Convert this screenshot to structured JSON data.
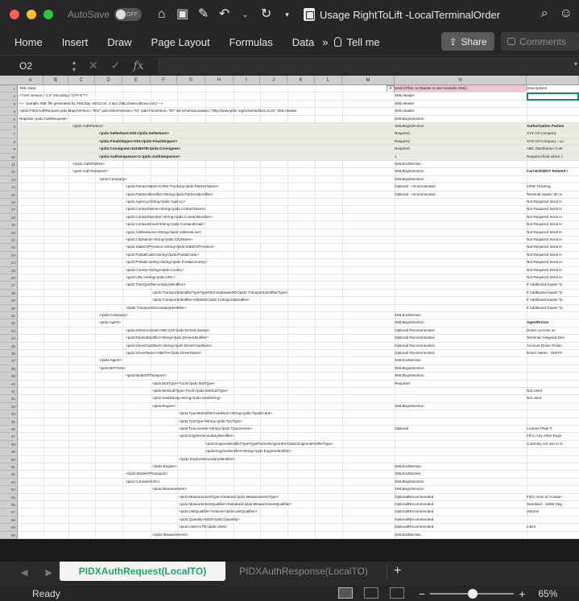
{
  "window": {
    "autosave_label": "AutoSave",
    "autosave_state": "OFF",
    "document_title": "Usage RightToLift -LocalTerminalOrder"
  },
  "ribbon": {
    "tabs": [
      "Home",
      "Insert",
      "Draw",
      "Page Layout",
      "Formulas",
      "Data"
    ],
    "more": "»",
    "tell_me": "Tell me",
    "share": "Share",
    "comments": "Comments"
  },
  "formula_bar": {
    "name_box": "O2",
    "fx": "fx",
    "value": ""
  },
  "grid": {
    "column_letters": [
      "A",
      "B",
      "C",
      "D",
      "E",
      "F",
      "G",
      "H",
      "I",
      "J",
      "K",
      "L",
      "M",
      "N"
    ],
    "col_n_header": "Used (Filter on Blanks to see example XML)",
    "col_o_header": "Descriptions",
    "rows": [
      {
        "num": "1",
        "a": "XML Data",
        "indent": 0,
        "n": "Used (Filter on Blanks to see example XML)",
        "o": "Descriptions",
        "hl": false,
        "hdr": true
      },
      {
        "num": "2",
        "a": "<?xml version=\"1.0\" encoding=\"UTF-8\"?>",
        "indent": 0,
        "n": "XMLHeader",
        "o": "",
        "hl": false
      },
      {
        "num": "3",
        "a": "<!-- Sample XML file generated by XMLSpy v2012 rel. 2 sp1 (http://www.altova.com) -->",
        "indent": 0,
        "n": "XMLHeader",
        "o": "",
        "hl": false
      },
      {
        "num": "4",
        "a": "<pidx:PIDXAuthRequest pidx:MajorVersion=\"001\" pidx:MinorVersion=\"01\" pidx:FixVersion=\"00\" xsi:schemaLocation=\"http://www.pidx.org/schema/lds/LIS.01\" XMLHeader",
        "indent": 0,
        "n": "XMLHeader",
        "o": "",
        "hl": false
      },
      {
        "num": "5",
        "a": "Repeats   <pidx:AuthRequest>",
        "indent": 0,
        "n": "XMLBeginSection",
        "o": "",
        "hl": false
      },
      {
        "num": "6",
        "a": "<pidx:AuthParties>",
        "indent": 2,
        "n": "XMLBeginSection",
        "o": "Authorization Parties",
        "hl": true,
        "bold": true
      },
      {
        "num": "7",
        "a": "<pidx:SellerNum>001</pidx:SellerNum>",
        "indent": 3,
        "n": "Required",
        "o": "XYZ Oil Company",
        "hl": true,
        "b": true
      },
      {
        "num": "8",
        "a": "<pidx:FinalShipper>001</pidx:FinalShipper>",
        "indent": 3,
        "n": "Required",
        "o": "XYZ Oil Company - Lo",
        "hl": true,
        "b": true
      },
      {
        "num": "9",
        "a": "<pidx:Consignee>12345678</pidx:Consignee>",
        "indent": 3,
        "n": "Required",
        "o": "ABC Distribution Cust",
        "hl": true,
        "b": true
      },
      {
        "num": "10",
        "a": "<pidx:AuthSequence>1</pidx:AuthSequence>",
        "indent": 3,
        "n": "1",
        "o": "Required field which c",
        "hl": true,
        "b": true
      },
      {
        "num": "11",
        "a": "</pidx:AuthParties>",
        "indent": 2,
        "n": "XMLEndSection",
        "o": "",
        "hl": false
      },
      {
        "num": "12",
        "a": "<pidx:AuthTransport>",
        "indent": 2,
        "n": "XMLBeginSection",
        "o": "Carrier/DWOT Related I",
        "hl": false,
        "bold": true
      },
      {
        "num": "13",
        "a": "<pidx:Company>",
        "indent": 3,
        "n": "XMLBeginSection",
        "o": "",
        "hl": false
      },
      {
        "num": "14",
        "a": "<pidx:PartnerName>CRW Trucking</pidx:PartnerName>",
        "indent": 4,
        "n": "Optional - recommended",
        "o": "CRW Trucking",
        "hl": false
      },
      {
        "num": "15",
        "a": "<pidx:PartnerIdentifier>String</pidx:PartnerIdentifier>",
        "indent": 4,
        "n": "Optional - recommended",
        "o": "Terminal Hauler ID cu",
        "hl": false
      },
      {
        "num": "16",
        "a": "<pidx:Agency>String</pidx:Agency>",
        "indent": 4,
        "n": "",
        "o": "Not Required Send in",
        "hl": false
      },
      {
        "num": "17",
        "a": "<pidx:ContactName>String</pidx:ContactName>",
        "indent": 4,
        "n": "",
        "o": "Not Required Send in",
        "hl": false
      },
      {
        "num": "18",
        "a": "<pidx:ContactNumber>String</pidx:ContactNumber>",
        "indent": 4,
        "n": "",
        "o": "Not Required Send in",
        "hl": false
      },
      {
        "num": "19",
        "a": "<pidx:ContactEmail>String</pidx:ContactEmail>",
        "indent": 4,
        "n": "",
        "o": "Not Required Send in",
        "hl": false
      },
      {
        "num": "20",
        "a": "<pidx:AddressLine>String</pidx:AddressLine>",
        "indent": 4,
        "n": "",
        "o": "Not Required Send in",
        "hl": false
      },
      {
        "num": "21",
        "a": "<pidx:CityName>String</pidx:CityName>",
        "indent": 4,
        "n": "",
        "o": "Not Required Send in",
        "hl": false
      },
      {
        "num": "22",
        "a": "<pidx:StateOrProvince>String</pidx:StateOrProvince>",
        "indent": 4,
        "n": "",
        "o": "Not Required Send in",
        "hl": false
      },
      {
        "num": "23",
        "a": "<pidx:PostalCode>String</pidx:PostalCode>",
        "indent": 4,
        "n": "",
        "o": "Not Required Send in",
        "hl": false
      },
      {
        "num": "24",
        "a": "<pidx:PostalCountry>String</pidx:PostalCountry>",
        "indent": 4,
        "n": "",
        "o": "Not Required Send in",
        "hl": false
      },
      {
        "num": "25",
        "a": "<pidx:County>String</pidx:County>",
        "indent": 4,
        "n": "",
        "o": "Not Required Send in",
        "hl": false
      },
      {
        "num": "26",
        "a": "<pidx:URL>String</pidx:URL>",
        "indent": 4,
        "n": "",
        "o": "Not Required Send in",
        "hl": false
      },
      {
        "num": "27",
        "a": "<pidx:TransportSecondaryIdentifier>",
        "indent": 4,
        "n": "",
        "o": "If Additional Hauler Ty",
        "hl": false
      },
      {
        "num": "28",
        "a": "<pidx:TransportIdentifierTypeTypeTerminalHaulerID</pidx:TransportIdentifierType>",
        "indent": 5,
        "n": "",
        "o": "If Additional Hauler Ty",
        "hl": false
      },
      {
        "num": "29",
        "a": "<pidx:TransportIdentifier>000000</pidx:TransportIdentifier>",
        "indent": 5,
        "n": "",
        "o": "If Additional Hauler Ty",
        "hl": false
      },
      {
        "num": "30",
        "a": "</pidx:TransportSecondaryIdentifier>",
        "indent": 4,
        "n": "",
        "o": "If Additional Hauler Ty",
        "hl": false
      },
      {
        "num": "31",
        "a": "</pidx:Company>",
        "indent": 3,
        "n": "XMLEndSection",
        "o": "",
        "hl": false
      },
      {
        "num": "32",
        "a": "<pidx:Agent>",
        "indent": 3,
        "n": "XMLBeginSection",
        "o": "Agent/Driver",
        "hl": false,
        "bold": true
      },
      {
        "num": "33",
        "a": "<pidx:DriverLicense>ABC123</pidx:DriverLicense>",
        "indent": 4,
        "n": "Optional Recommended",
        "o": "Driver License no",
        "hl": false
      },
      {
        "num": "34",
        "a": "<pidx:DriverIdentifier>String</pidx:DriverIdentifier>",
        "indent": 4,
        "n": "Optional Recommended",
        "o": "Terminal Assigned Driv",
        "hl": false
      },
      {
        "num": "35",
        "a": "<pidx:DriverCardNum>String</pidx:DriverCardNum>",
        "indent": 4,
        "n": "Optional Recommended",
        "o": "Account Driver Pickin",
        "hl": false
      },
      {
        "num": "36",
        "a": "<pidx:DriverName>SMITH</pidx:DriverName>",
        "indent": 4,
        "n": "Optional Recommended",
        "o": "Driver Name - SMITH",
        "hl": false
      },
      {
        "num": "37",
        "a": "</pidx:Agent>",
        "indent": 3,
        "n": "XMLEndSection",
        "o": "",
        "hl": false
      },
      {
        "num": "38",
        "a": "<pidx:MOTInfo>",
        "indent": 3,
        "n": "XMLBeginSection",
        "o": "",
        "hl": false
      },
      {
        "num": "39",
        "a": "<pidx:ModeOfTransport>",
        "indent": 4,
        "n": "XMLBeginSection",
        "o": "",
        "hl": false
      },
      {
        "num": "40",
        "a": "<pidx:MotType>Truck</pidx:MotType>",
        "indent": 5,
        "n": "Required",
        "o": "",
        "hl": false
      },
      {
        "num": "41",
        "a": "<pidx:MotSubType>Truck</pidx:MotSubType>",
        "indent": 5,
        "n": "",
        "o": "Not Used",
        "hl": false
      },
      {
        "num": "42",
        "a": "<pidx:SealString>String</pidx:SealString>",
        "indent": 5,
        "n": "",
        "o": "Not used",
        "hl": false
      },
      {
        "num": "43",
        "a": "<pidx:Engine>",
        "indent": 5,
        "n": "XMLBeginSection",
        "o": "",
        "hl": false
      },
      {
        "num": "44",
        "a": "<pidx:TpunitIdentifierCardNum>String</pidx:TpuIDCard>",
        "indent": 6,
        "n": "",
        "o": "",
        "hl": false
      },
      {
        "num": "45",
        "a": "<pidx:TpuType>String</pidx:TpuType>",
        "indent": 6,
        "n": "",
        "o": "",
        "hl": false
      },
      {
        "num": "46",
        "a": "<pidx:TpuLicense>String</pidx:TpuLicense>",
        "indent": 6,
        "n": "Optional",
        "o": "License Plate #",
        "hl": false
      },
      {
        "num": "47",
        "a": "<pidx:EngineSecondaryIdentifier>",
        "indent": 6,
        "n": "",
        "o": "Fill in Any other Engir",
        "hl": false
      },
      {
        "num": "48",
        "a": "<pidx:EngineIdentifierTypeTypePartnerEngineIDs</pidx:EngineIdentifierType>",
        "indent": 7,
        "n": "",
        "o": "Currently not use in G",
        "hl": false
      },
      {
        "num": "49",
        "a": "<pidx:EngineIdentifier>String</pidx:EngineIdentifier>",
        "indent": 7,
        "n": "",
        "o": "",
        "hl": false
      },
      {
        "num": "50",
        "a": "</pidx:EngineSecondaryIdentifier>",
        "indent": 6,
        "n": "",
        "o": "",
        "hl": false
      },
      {
        "num": "51",
        "a": "</pidx:Engine>",
        "indent": 5,
        "n": "XMLEndSection",
        "o": "",
        "hl": false
      },
      {
        "num": "52",
        "a": "</pidx:ModeOfTransport>",
        "indent": 4,
        "n": "XMLEndSection",
        "o": "",
        "hl": false
      },
      {
        "num": "53",
        "a": "<pidx:ContainerInfo>",
        "indent": 4,
        "n": "XMLBeginSection",
        "o": "",
        "hl": false
      },
      {
        "num": "54",
        "a": "<pidx:Measurement>",
        "indent": 5,
        "n": "XMLBeginSection",
        "o": "",
        "hl": false
      },
      {
        "num": "55",
        "a": "<pidx:MeasurementType>Ordered</pidx:MeasurementType>",
        "indent": 6,
        "n": "OptionalRecommended",
        "o": "Fill in Sum of Contain",
        "hl": false
      },
      {
        "num": "56",
        "a": "<pidx:MeasurementQualifier>Standard</pidx:MeasurementQualifier>",
        "indent": 6,
        "n": "OptionalRecommended",
        "o": "Standard - 15/60 Deg",
        "hl": false
      },
      {
        "num": "57",
        "a": "<pidx:UnitQualifier>Volume</pidx:UnitQualifier>",
        "indent": 6,
        "n": "OptionalRecommended",
        "o": "Volume",
        "hl": false
      },
      {
        "num": "58",
        "a": "<pidx:Quantity>9400</pidx:Quantity>",
        "indent": 6,
        "n": "OptionalRecommended",
        "o": "",
        "hl": false
      },
      {
        "num": "59",
        "a": "<pidx:Units>LTR</pidx:Units>",
        "indent": 6,
        "n": "OptionalRecommended",
        "o": "Liters",
        "hl": false
      },
      {
        "num": "60",
        "a": "</pidx:Measurement>",
        "indent": 5,
        "n": "XMLEndSection",
        "o": "",
        "hl": false
      }
    ]
  },
  "sheet_tabs": {
    "active": "PIDXAuthRequest(LocalTO)",
    "inactive": "PIDXAuthResponse(LocalTO)",
    "add": "+"
  },
  "status_bar": {
    "status": "Ready",
    "zoom_minus": "−",
    "zoom_plus": "+",
    "zoom_percent": "65%",
    "zoom_level": 65
  },
  "colors": {
    "accent_green": "#21a366",
    "highlight_row": "#ecebe2",
    "header_pink": "#f3c4cf"
  }
}
